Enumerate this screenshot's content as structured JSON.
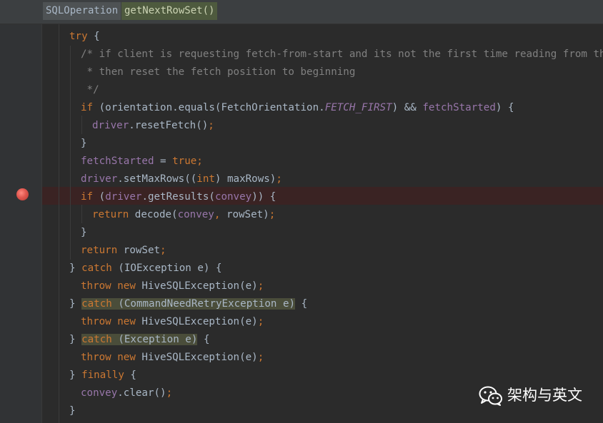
{
  "breadcrumbs": [
    "SQLOperation",
    "getNextRowSet()"
  ],
  "watermark": "架构与英文",
  "colors": {
    "background": "#2b2b2b",
    "keyword": "#cc7832",
    "field": "#9876aa",
    "comment": "#808080",
    "text": "#a9b7c6",
    "breakpoint": "#e0574f"
  },
  "code": {
    "l01": {
      "a": "try",
      "b": " {"
    },
    "l02": "/* if client is requesting fetch-from-start and its not the first time reading from this operation,",
    "l03": " * then reset the fetch position to beginning",
    "l04": " */",
    "l05": {
      "a": "if",
      "b": " (orientation.equals(FetchOrientation.",
      "c": "FETCH_FIRST",
      "d": ") && ",
      "e": "fetchStarted",
      "f": ") {"
    },
    "l06": {
      "a": "driver",
      "b": ".resetFetch()",
      "c": ";"
    },
    "l07": "}",
    "l08": {
      "a": "fetchStarted",
      "b": " = ",
      "c": "true",
      "d": ";"
    },
    "l09": {
      "a": "driver",
      "b": ".setMaxRows((",
      "c": "int",
      "d": ") maxRows)",
      "e": ";"
    },
    "l10": {
      "a": "if",
      "b": " (",
      "c": "driver",
      "d": ".getResults(",
      "e": "convey",
      "f": ")) {"
    },
    "l11": {
      "a": "return",
      "b": " decode(",
      "c": "convey",
      "d": ", ",
      "e": "rowSet)",
      "f": ";"
    },
    "l12": "}",
    "l13": {
      "a": "return",
      "b": " rowSet",
      "c": ";"
    },
    "l14": {
      "a": "} ",
      "b": "catch",
      "c": " (IOException e) {"
    },
    "l15": {
      "a": "throw new",
      "b": " HiveSQLException(e)",
      "c": ";"
    },
    "l16": {
      "a": "} ",
      "b": "catch",
      "c": " (CommandNeedRetryException e)",
      "d": " {"
    },
    "l17": {
      "a": "throw new",
      "b": " HiveSQLException(e)",
      "c": ";"
    },
    "l18": {
      "a": "} ",
      "b": "catch",
      "c": " (Exception e)",
      "d": " {"
    },
    "l19": {
      "a": "throw new",
      "b": " HiveSQLException(e)",
      "c": ";"
    },
    "l20": {
      "a": "} ",
      "b": "finally",
      "c": " {"
    },
    "l21": {
      "a": "convey",
      "b": ".clear()",
      "c": ";"
    },
    "l22": "}"
  }
}
